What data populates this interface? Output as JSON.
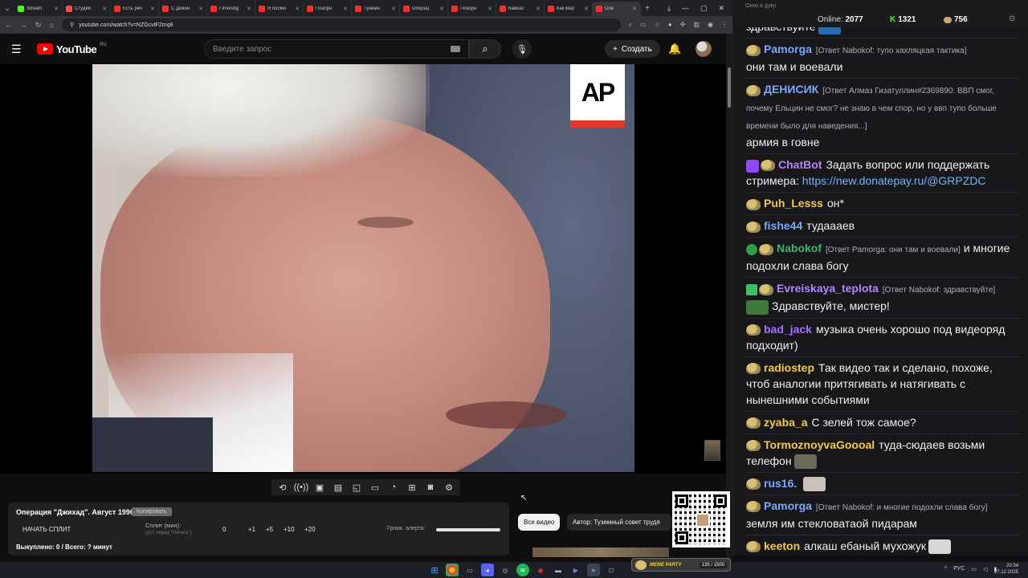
{
  "browser": {
    "tabs": [
      {
        "label": "Stream",
        "color": "#53fc18"
      },
      {
        "label": "Студия",
        "color": "#ff4d4d"
      },
      {
        "label": "Есть реч",
        "color": "#ff2d2d"
      },
      {
        "label": "С Девон",
        "color": "#ff2d2d"
      },
      {
        "label": "I Investig",
        "color": "#ff2d2d"
      },
      {
        "label": "Я посмо",
        "color": "#ff2d2d"
      },
      {
        "label": "Позорн",
        "color": "#ff2d2d"
      },
      {
        "label": "Туземн",
        "color": "#ff2d2d"
      },
      {
        "label": "Операц",
        "color": "#ff2d2d"
      },
      {
        "label": "Позорн",
        "color": "#ff2d2d"
      },
      {
        "label": "Кавказ",
        "color": "#ff2d2d"
      },
      {
        "label": "Как мар",
        "color": "#ff2d2d"
      },
      {
        "label": "Опе",
        "color": "#ff2d2d"
      }
    ],
    "url": "youtube.com/watch?v=NZGcvtF2mq8"
  },
  "youtube": {
    "logo_text": "YouTube",
    "region": "RU",
    "search_placeholder": "Введите запрос",
    "create_label": "Создать"
  },
  "video": {
    "watermark": "AP"
  },
  "split_panel": {
    "title": "Операция \"Джихад\". Август 1996.",
    "badge": "Копировать",
    "start_label": "НАЧАТЬ СПЛИТ",
    "minutes_label": "Сплит (мин):",
    "minutes_hint": "(уст. перед \"Начать\")",
    "buttons": [
      "0",
      "+1",
      "+5",
      "+10",
      "+20"
    ],
    "volume_label": "Громк. алерта:",
    "bought_label": "Выкуплено: 0 / Всего: ? минут"
  },
  "chips": {
    "all_videos": "Все видео",
    "author": "Автор: Туземный совет трудя"
  },
  "chat_header": {
    "caption": "Окно в дуку",
    "online_label": "Online:",
    "online_count": "2077",
    "stat1": "1321",
    "stat2": "756"
  },
  "chat": [
    {
      "user": "",
      "reply": "",
      "text": "здравствуйте",
      "emote": "#2b6cb0"
    },
    {
      "user": "Pamorga",
      "color": "#7aa7ff",
      "reply": "[Ответ Nabokof: тупо хахляцкая тактика]",
      "text": "они там и воевали"
    },
    {
      "user": "ДЕНИСИК",
      "color": "#7aa7ff",
      "reply": "[Ответ Алмаз Гизатуллин#2369890: ВВП смог, почему Ельцин не смог? не знаю в чем спор, но у ввп тупо больше времени было для наведения...]",
      "text": "армия в говне"
    },
    {
      "user": "ChatBot",
      "color": "#b286ff",
      "reply": "",
      "text": "Задать вопрос или поддержать стримера:",
      "link": "https://new.donatepay.ru/@GRPZDC",
      "bot": true
    },
    {
      "user": "Puh_Lesss",
      "color": "#f2c94c",
      "reply": "",
      "text": "он*"
    },
    {
      "user": "fishe44",
      "color": "#7aa7ff",
      "reply": "",
      "text": "тудаааев"
    },
    {
      "user": "Nabokof",
      "color": "#3cb371",
      "reply": "[Ответ Pamorga: они там и воевали]",
      "text": "и многие подохли слава богу",
      "ok": true
    },
    {
      "user": "Evreiskaya_teplota",
      "color": "#b286ff",
      "reply": "[Ответ Nabokof: здравствуйте]",
      "text": "Здравствуйте, мистер!",
      "edit": true,
      "emote": "#3f7a3a"
    },
    {
      "user": "bad_jack",
      "color": "#a970ff",
      "reply": "",
      "text": "музыка очень хорошо под видеоряд подходит)"
    },
    {
      "user": "radiostep",
      "color": "#f2c94c",
      "reply": "",
      "text": "Так видео так и сделано, похоже, чтоб аналогии притягивать и натягивать с нынешними событиями"
    },
    {
      "user": "zyaba_a",
      "color": "#f2c94c",
      "reply": "",
      "text": "С зелей тож самое?"
    },
    {
      "user": "TormoznoyvaGoooal",
      "color": "#f2c94c",
      "reply": "",
      "text": "туда-сюдаев возьми телефон",
      "emote": "#6b6a5a"
    },
    {
      "user": "rus16.",
      "color": "#7aa7ff",
      "reply": "",
      "text": "",
      "emote": "#c9c2b8"
    },
    {
      "user": "Pamorga",
      "color": "#7aa7ff",
      "reply": "[Ответ Nabokof: и многие подохли слава богу]",
      "text": "земля им стекловатаой пидарам"
    },
    {
      "user": "keeton",
      "color": "#f2c94c",
      "reply": "",
      "text": "алкаш ебаный мухожук",
      "emote": "#d7d7d7"
    }
  ],
  "taskbar": {
    "widget_title": "MEME PARTY",
    "widget_count": "135 / 1500",
    "lang": "РУС",
    "time": "20:34",
    "date": "27.12.2025"
  }
}
